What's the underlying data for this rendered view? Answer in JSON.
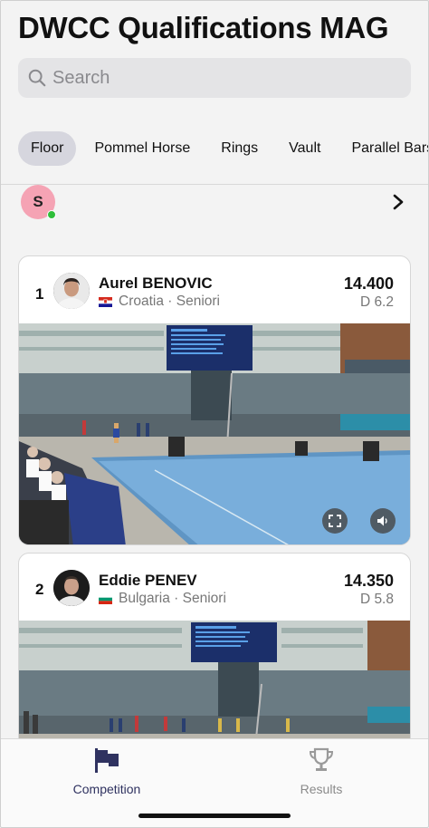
{
  "header": {
    "title": "DWCC Qualifications MAG"
  },
  "search": {
    "placeholder": "Search"
  },
  "tabs": [
    {
      "label": "Floor",
      "active": true
    },
    {
      "label": "Pommel Horse"
    },
    {
      "label": "Rings"
    },
    {
      "label": "Vault"
    },
    {
      "label": "Parallel Bars"
    }
  ],
  "user": {
    "initial": "S",
    "status": "online"
  },
  "results": [
    {
      "rank": "1",
      "name": "Aurel BENOVIC",
      "country": "Croatia",
      "category": "Seniori",
      "score": "14.400",
      "difficulty": "D 6.2"
    },
    {
      "rank": "2",
      "name": "Eddie PENEV",
      "country": "Bulgaria",
      "category": "Seniori",
      "score": "14.350",
      "difficulty": "D 5.8"
    }
  ],
  "bottom_nav": [
    {
      "label": "Competition",
      "icon": "flag-icon",
      "active": true
    },
    {
      "label": "Results",
      "icon": "trophy-icon",
      "active": false
    }
  ],
  "colors": {
    "active_tab_bg": "#d6d6de",
    "avatar_bg": "#f5a3b4",
    "online": "#2fbe3a",
    "nav_active": "#2f3260",
    "nav_inactive": "#9a9a9a"
  }
}
